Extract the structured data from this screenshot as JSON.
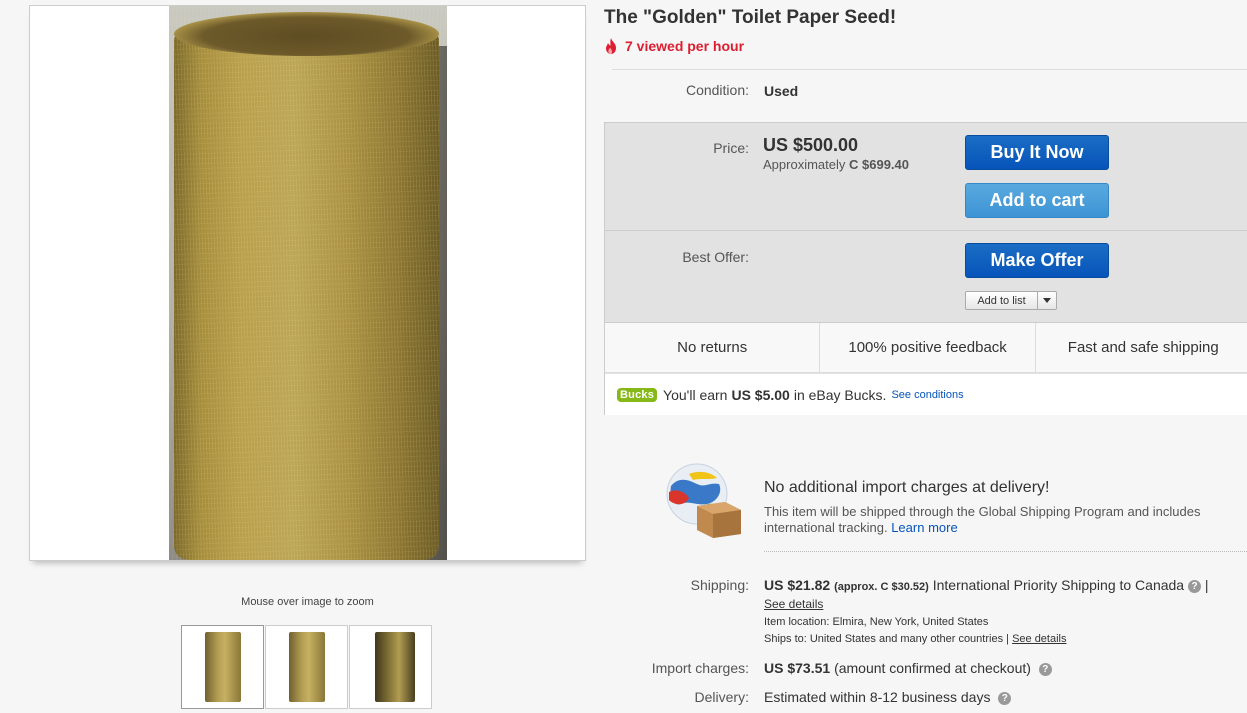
{
  "gallery": {
    "zoom_hint": "Mouse over image to zoom"
  },
  "item": {
    "title": "The \"Golden\" Toilet Paper Seed!",
    "views": "7 viewed per hour"
  },
  "condition": {
    "label": "Condition:",
    "value": "Used"
  },
  "price": {
    "label": "Price:",
    "value": "US $500.00",
    "approx_prefix": "Approximately",
    "approx_value": "C $699.40"
  },
  "buttons": {
    "buy_now": "Buy It Now",
    "add_to_cart": "Add to cart",
    "make_offer": "Make Offer",
    "add_to_list": "Add to list"
  },
  "best_offer": {
    "label": "Best Offer:"
  },
  "features": [
    "No returns",
    "100% positive feedback",
    "Fast and safe shipping"
  ],
  "bucks": {
    "badge": "Bucks",
    "earn_prefix": "You'll earn",
    "amount": "US $5.00",
    "earn_suffix": "in eBay Bucks.",
    "link": "See conditions"
  },
  "gsp": {
    "title": "No additional import charges at delivery!",
    "description": "This item will be shipped through the Global Shipping Program and includes international tracking.",
    "learn_more": "Learn more"
  },
  "shipping": {
    "label": "Shipping:",
    "cost": "US $21.82",
    "approx": "(approx. C $30.52)",
    "service": "International Priority Shipping to Canada",
    "see_details": "See details",
    "item_location": "Item location:  Elmira, New York, United States",
    "ships_to": "Ships to:  United States and many other countries |",
    "ships_to_link": "See details"
  },
  "import_charges": {
    "label": "Import charges:",
    "amount": "US $73.51",
    "note": "(amount confirmed at checkout)"
  },
  "delivery": {
    "label": "Delivery:",
    "value": "Estimated within 8-12 business days"
  },
  "colors": {
    "accent_blue": "#0654ba",
    "views_red": "#dd1e31",
    "bucks_green": "#86b817"
  }
}
